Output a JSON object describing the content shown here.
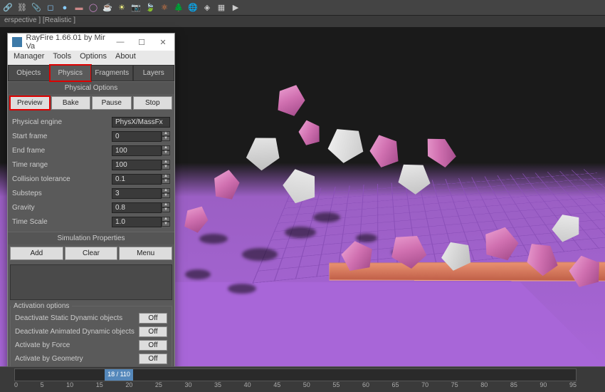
{
  "viewport_label": "erspective ] [Realistic ]",
  "rayfire": {
    "title": "RayFire 1.66.01  by Mir Va",
    "menu": [
      "Manager",
      "Tools",
      "Options",
      "About"
    ],
    "tabs": [
      "Objects",
      "Physics",
      "Fragments",
      "Layers"
    ],
    "active_tab": "Physics",
    "physical_options_label": "Physical Options",
    "action_buttons": [
      "Preview",
      "Bake",
      "Pause",
      "Stop"
    ],
    "engine_label": "Physical engine",
    "engine_value": "PhysX/MassFx",
    "params": [
      {
        "label": "Start frame",
        "value": "0"
      },
      {
        "label": "End frame",
        "value": "100"
      },
      {
        "label": "Time range",
        "value": "100"
      },
      {
        "label": "Collision tolerance",
        "value": "0.1"
      },
      {
        "label": "Substeps",
        "value": "3"
      },
      {
        "label": "Gravity",
        "value": "0.8"
      },
      {
        "label": "Time Scale",
        "value": "1.0"
      }
    ],
    "sim_props_label": "Simulation Properties",
    "sim_buttons": [
      "Add",
      "Clear",
      "Menu"
    ],
    "activation_label": "Activation options",
    "activation": [
      {
        "label": "Deactivate Static Dynamic objects",
        "state": "Off"
      },
      {
        "label": "Deactivate Animated Dynamic objects",
        "state": "Off"
      },
      {
        "label": "Activate by Force",
        "state": "Off"
      },
      {
        "label": "Activate by Geometry",
        "state": "Off"
      }
    ]
  },
  "timeline": {
    "cursor": "18 / 110",
    "cursor_pct": 16,
    "ticks": [
      "0",
      "5",
      "10",
      "15",
      "20",
      "25",
      "30",
      "35",
      "40",
      "45",
      "50",
      "55",
      "60",
      "65",
      "70",
      "75",
      "80",
      "85",
      "90",
      "95"
    ]
  },
  "toolbar_icons": [
    "link",
    "unlink",
    "bind",
    "sep",
    "cube",
    "sphere",
    "cylinder",
    "torus",
    "tube",
    "teapot",
    "sep",
    "light",
    "camera",
    "sep",
    "leaf",
    "atom",
    "tree",
    "sep",
    "globe",
    "snap",
    "grid",
    "magnet",
    "sep",
    "render"
  ]
}
